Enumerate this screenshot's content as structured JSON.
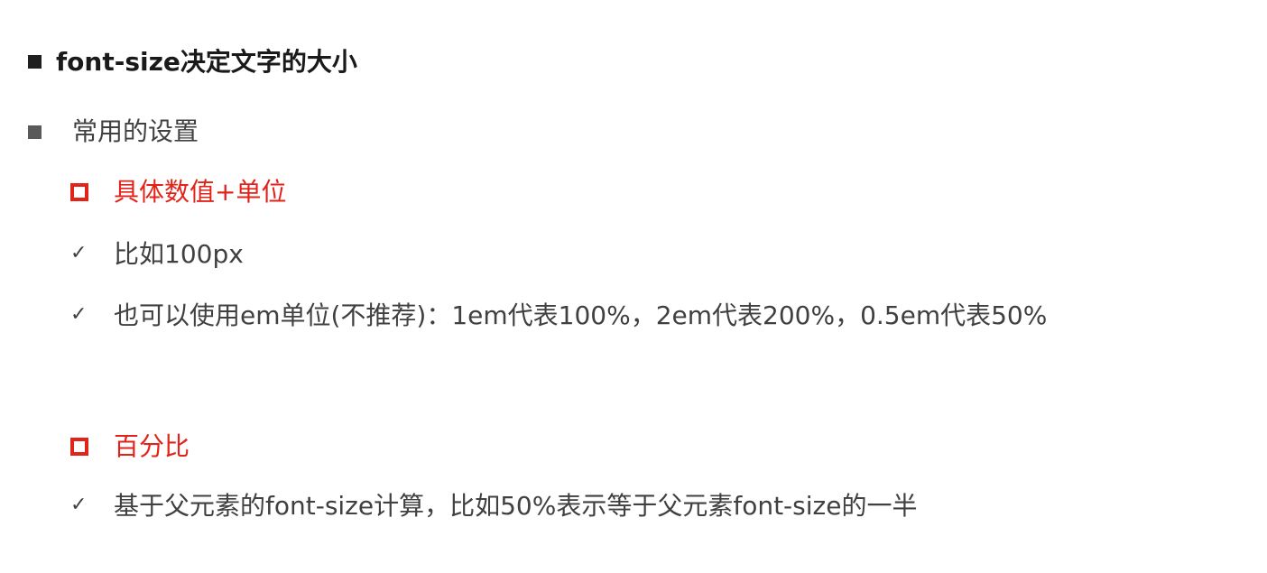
{
  "bullets": {
    "heading": "font-size决定文字的大小",
    "common": "常用的设置",
    "specific": {
      "label": "具体数值+单位",
      "items": [
        "比如100px",
        "也可以使用em单位(不推荐)：1em代表100%，2em代表200%，0.5em代表50%"
      ]
    },
    "percent": {
      "label": "百分比",
      "items": [
        "基于父元素的font-size计算，比如50%表示等于父元素font-size的一半"
      ]
    }
  },
  "icons": {
    "level1": "filled-square-icon",
    "level2": "hollow-square-icon",
    "level3": "check-icon"
  },
  "colors": {
    "accent": "#e2231a",
    "text": "#404040",
    "heading": "#1a1a1a"
  }
}
